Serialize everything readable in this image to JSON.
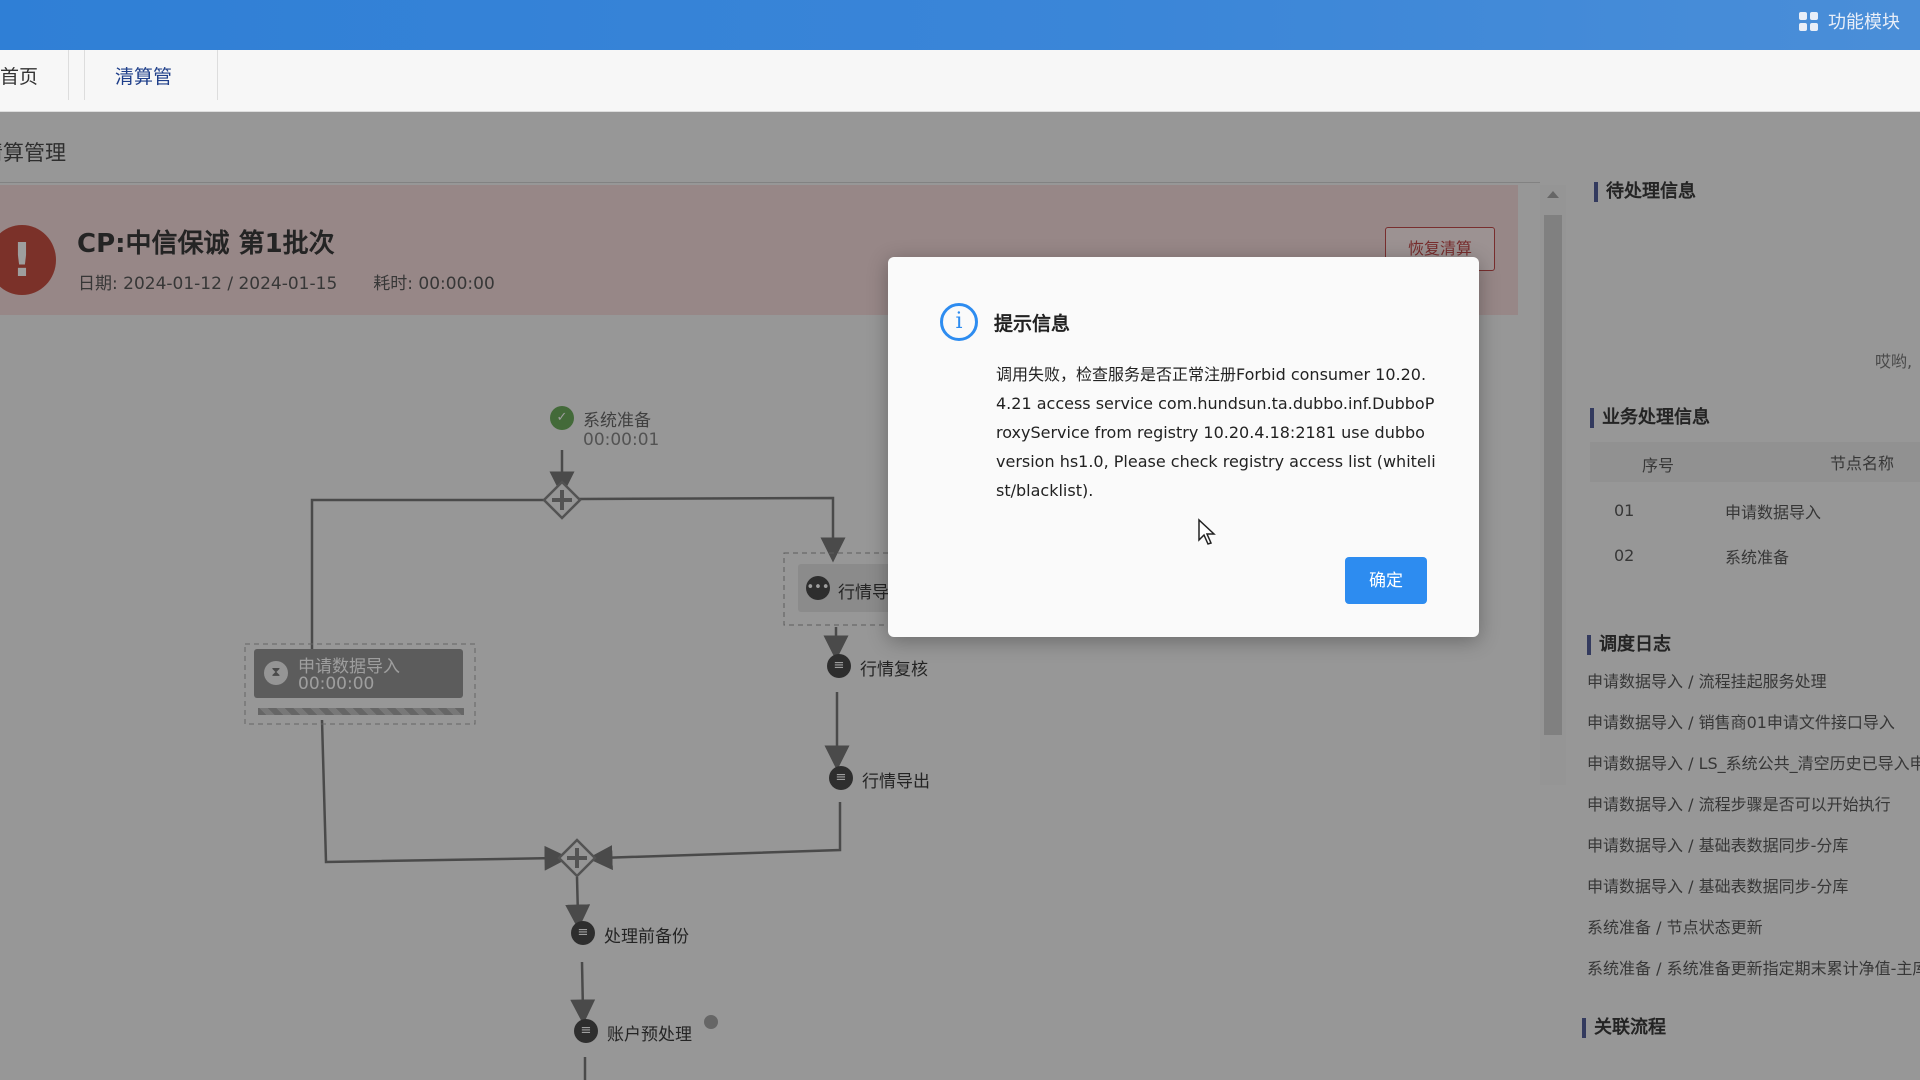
{
  "topbar": {
    "modules_label": "功能模块"
  },
  "tabs": [
    {
      "label": "首页"
    },
    {
      "label": "清算管理"
    }
  ],
  "breadcrumb": "清算管理",
  "batch": {
    "title": "CP:中信保诚 第1批次",
    "date_label": "日期:",
    "date_value": "2024-01-12 / 2024-01-15",
    "elapsed_label": "耗时:",
    "elapsed_value": "00:00:00",
    "resume_button": "恢复清算"
  },
  "flow": {
    "nodes": [
      {
        "label": "系统准备",
        "time": "00:00:01",
        "status": "done"
      },
      {
        "label": "申请数据导入",
        "time": "00:00:00",
        "status": "waiting"
      },
      {
        "label": "行情导入",
        "status": "running"
      },
      {
        "label": "行情复核"
      },
      {
        "label": "行情导出"
      },
      {
        "label": "处理前备份"
      },
      {
        "label": "账户预处理"
      }
    ]
  },
  "right_panel": {
    "pending_title": "待处理信息",
    "pending_text": "哎哟,",
    "business_title": "业务处理信息",
    "table": {
      "headers": [
        "序号",
        "节点名称"
      ],
      "rows": [
        [
          "01",
          "申请数据导入"
        ],
        [
          "02",
          "系统准备"
        ]
      ]
    },
    "log_title": "调度日志",
    "logs": [
      "申请数据导入 / 流程挂起服务处理",
      "申请数据导入 / 销售商01申请文件接口导入",
      "申请数据导入 / LS_系统公共_清空历史已导入申",
      "申请数据导入 / 流程步骤是否可以开始执行",
      "申请数据导入 / 基础表数据同步-分库",
      "申请数据导入 / 基础表数据同步-分库",
      "系统准备 / 节点状态更新",
      "系统准备 / 系统准备更新指定期末累计净值-主库"
    ],
    "related_title": "关联流程"
  },
  "dialog": {
    "title": "提示信息",
    "message": "调用失败，检查服务是否正常注册Forbid consumer 10.20.4.21 access service com.hundsun.ta.dubbo.inf.DubboProxyService from registry 10.20.4.18:2181 use dubbo version hs1.0, Please check registry access list (whitelist/blacklist).",
    "ok_button": "确定"
  },
  "colors": {
    "accent": "#2d8cf0",
    "topbar": "#3b86d8",
    "error": "#c0392b",
    "done": "#4caf50"
  }
}
